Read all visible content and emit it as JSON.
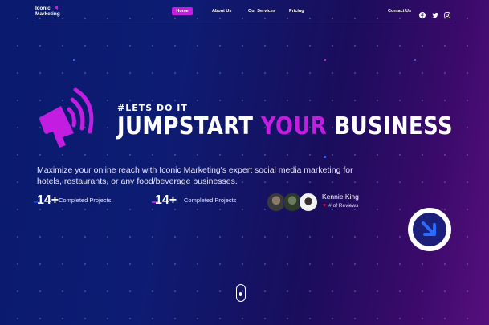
{
  "brand": {
    "name_line1": "Iconic",
    "name_line2": "Marketing"
  },
  "nav": {
    "home": "Home",
    "about": "About Us",
    "services": "Our Services",
    "pricing": "Pricing",
    "contact": "Contact Us"
  },
  "social": {
    "icons": [
      "facebook-icon",
      "twitter-icon",
      "instagram-icon"
    ]
  },
  "hero": {
    "tagline": "#LETS DO IT",
    "headline_part1": "JUMPSTART ",
    "headline_highlight": "YOUR",
    "headline_part2": " BUSINESS",
    "description": "Maximize your online reach with Iconic Marketing's expert social media marketing for hotels, restaurants, or any food/beverage businesses."
  },
  "stats": [
    {
      "number": "14+",
      "label": "Completed Projects"
    },
    {
      "number": "14+",
      "label": "Completed Projects"
    }
  ],
  "review": {
    "name": "Kennie King",
    "rating_text": "# of Reviews"
  },
  "colors": {
    "accent": "#c21de0",
    "blue": "#1a3ad6",
    "heart": "#e8132b"
  }
}
